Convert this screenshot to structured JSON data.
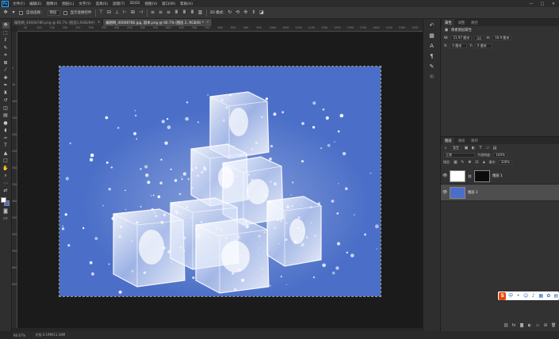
{
  "app": {
    "logo": "Ps",
    "menu": [
      "文件(F)",
      "编辑(E)",
      "图像(I)",
      "图层(L)",
      "文字(Y)",
      "选择(S)",
      "滤镜(T)",
      "3D(D)",
      "视图(V)",
      "窗口(W)",
      "帮助(H)"
    ],
    "window_controls": [
      "—",
      "□",
      "✕"
    ]
  },
  "options": {
    "auto_select_label": "自动选择：",
    "auto_select_value": "图层",
    "transform_label": "显示变换控件"
  },
  "tabs": [
    {
      "label": "编图网_40008780.png @ 66.7% (图层1,RGB/8#)",
      "close": "×",
      "active": false
    },
    {
      "label": "编图网_40008780.jpg, 副本.png @ 66.7% (图层 2, RGB/8) *",
      "close": "×",
      "active": true
    }
  ],
  "ruler": {
    "top": [
      "50",
      "100",
      "150",
      "200",
      "250",
      "300",
      "350",
      "400",
      "450",
      "500",
      "550",
      "600",
      "650",
      "700",
      "750",
      "800",
      "850",
      "900",
      "950",
      "1000",
      "1050",
      "1100",
      "1150",
      "1200",
      "1250",
      "1300",
      "1350",
      "1400",
      "1450",
      "1500",
      "1550"
    ],
    "left": [
      "0",
      "50",
      "100",
      "150",
      "200",
      "250",
      "300",
      "350",
      "400",
      "450",
      "500",
      "550",
      "600",
      "650"
    ]
  },
  "canvas": {
    "background": "#4b6fc8"
  },
  "status": {
    "zoom": "66.67%",
    "doc": "文档:3.19M/11.38M"
  },
  "properties": {
    "tabs": [
      "属性",
      "调整",
      "路径"
    ],
    "title": "像素图层属性",
    "w_label": "W:",
    "w_value": "21.97 厘米",
    "link": "GO",
    "h_label": "H:",
    "h_value": "16.9 厘米",
    "x_label": "X:",
    "x_value": "0 厘米",
    "y_label": "Y:",
    "y_value": "0 厘米"
  },
  "layers": {
    "tabs": [
      "图层",
      "通道",
      "路径"
    ],
    "kind_label": "类型",
    "blend_mode": "正常",
    "opacity_label": "不透明度:",
    "opacity_value": "100%",
    "lock_label": "锁定:",
    "fill_label": "填充:",
    "fill_value": "100%",
    "items": [
      {
        "name": "图层 1",
        "selected": false
      },
      {
        "name": "图层 2",
        "selected": true
      }
    ]
  },
  "ime": {
    "logo": "S"
  }
}
